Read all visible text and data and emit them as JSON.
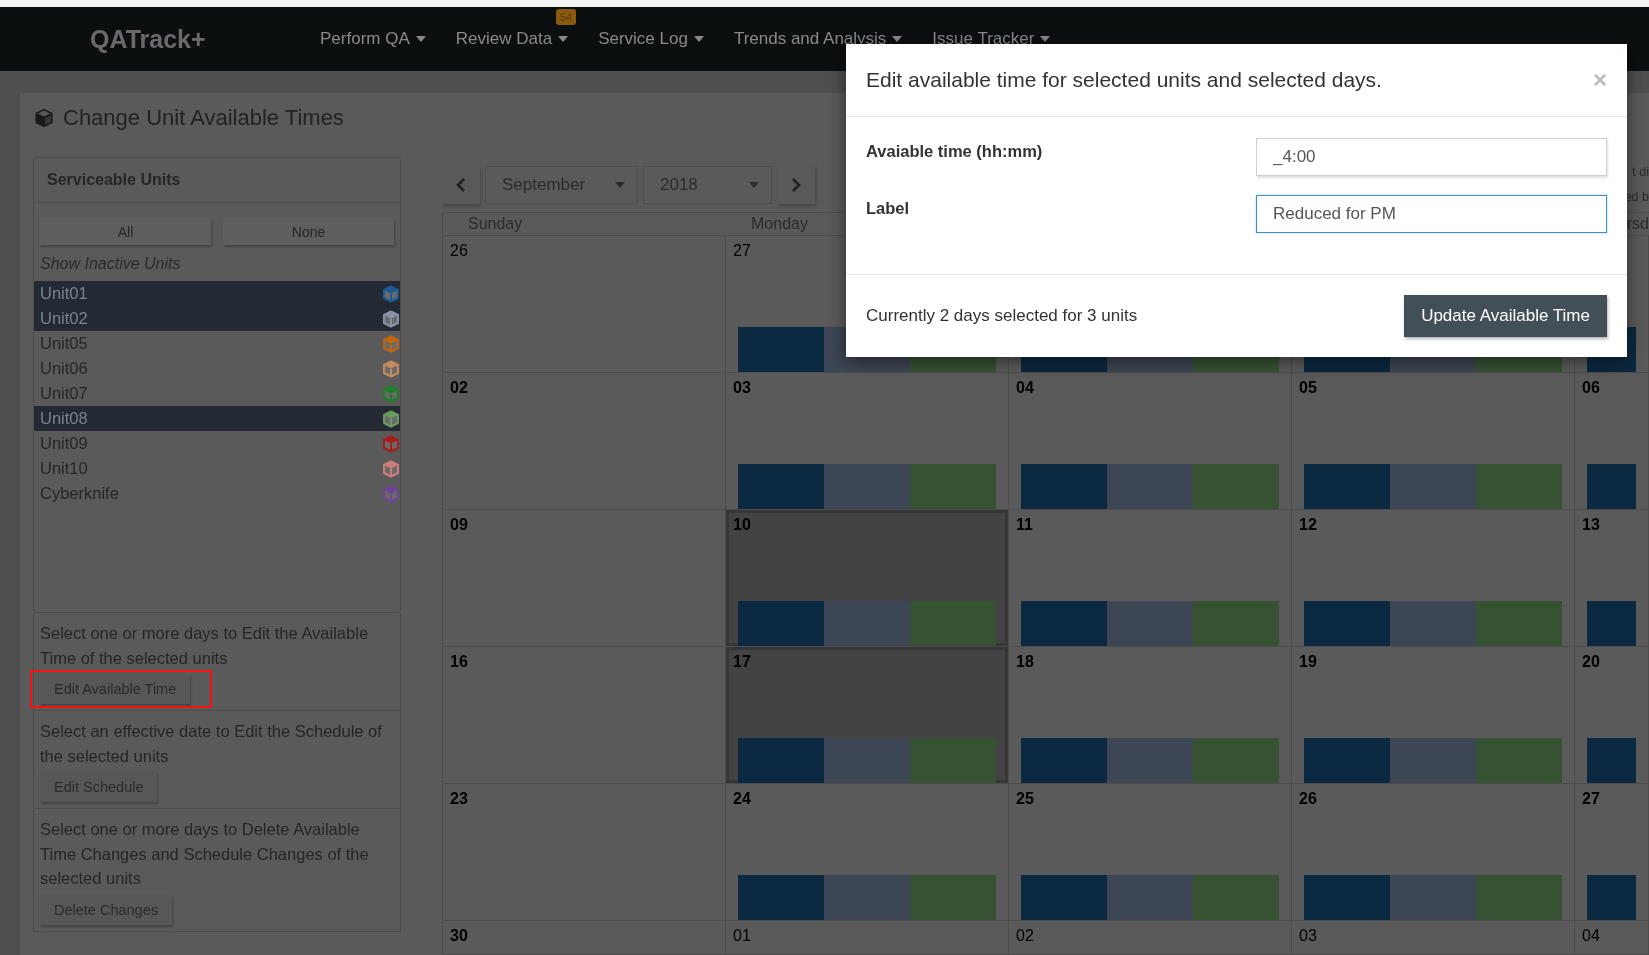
{
  "navbar": {
    "brand": "QATrack+",
    "items": [
      {
        "label": "Perform QA"
      },
      {
        "label": "Review Data",
        "badge": "54"
      },
      {
        "label": "Service Log"
      },
      {
        "label": "Trends and Analysis"
      },
      {
        "label": "Issue Tracker"
      }
    ]
  },
  "page": {
    "title": "Change Unit Available Times"
  },
  "units_panel": {
    "title": "Serviceable Units",
    "buttons": [
      "All",
      "None"
    ],
    "inactive_toggle": "Show Inactive Units",
    "units": [
      {
        "name": "Unit01",
        "selected": true,
        "color": "#1d5b94"
      },
      {
        "name": "Unit02",
        "selected": true,
        "color": "#8a93a6"
      },
      {
        "name": "Unit05",
        "selected": false,
        "color": "#c2660e"
      },
      {
        "name": "Unit06",
        "selected": false,
        "color": "#c48b5c"
      },
      {
        "name": "Unit07",
        "selected": false,
        "color": "#1e7f26"
      },
      {
        "name": "Unit08",
        "selected": true,
        "color": "#6a9a5e"
      },
      {
        "name": "Unit09",
        "selected": false,
        "color": "#a81b1b"
      },
      {
        "name": "Unit10",
        "selected": false,
        "color": "#d07c7c"
      },
      {
        "name": "Cyberknife",
        "selected": false,
        "color": "#6e4596"
      }
    ]
  },
  "actions": [
    {
      "text": "Select one or more days to Edit the Available Time of the selected units",
      "button": "Edit Available Time",
      "highlighted": true
    },
    {
      "text": "Select an effective date to Edit the Schedule of the selected units",
      "button": "Edit Schedule",
      "highlighted": false
    },
    {
      "text": "Select one or more days to Delete Available Time Changes and Schedule Changes of the selected units",
      "button": "Delete Changes",
      "highlighted": false
    }
  ],
  "calendar": {
    "month": "September",
    "year": "2018",
    "fragments": [
      "t di",
      "ed b"
    ],
    "weekday_headers": {
      "column_1": "Sunday",
      "column_2": "Monday",
      "column_5": "rsd"
    },
    "weeks": [
      [
        {
          "number": "26",
          "in_month": false,
          "selected": false,
          "bar": false
        },
        {
          "number": "27",
          "in_month": false,
          "selected": false,
          "bar": true
        },
        {
          "selected": false,
          "bar": true
        },
        {
          "selected": false,
          "bar": true
        },
        {
          "selected": false,
          "bar": true
        }
      ],
      [
        {
          "number": "02",
          "in_month": true,
          "selected": false,
          "bar": false
        },
        {
          "number": "03",
          "in_month": true,
          "selected": false,
          "bar": true
        },
        {
          "number": "04",
          "in_month": true,
          "selected": false,
          "bar": true
        },
        {
          "number": "05",
          "in_month": true,
          "selected": false,
          "bar": true
        },
        {
          "number": "06",
          "in_month": true,
          "selected": false,
          "bar": true
        }
      ],
      [
        {
          "number": "09",
          "in_month": true,
          "selected": false,
          "bar": false
        },
        {
          "number": "10",
          "in_month": true,
          "selected": true,
          "bar": true
        },
        {
          "number": "11",
          "in_month": true,
          "selected": false,
          "bar": true
        },
        {
          "number": "12",
          "in_month": true,
          "selected": false,
          "bar": true
        },
        {
          "number": "13",
          "in_month": true,
          "selected": false,
          "bar": true
        }
      ],
      [
        {
          "number": "16",
          "in_month": true,
          "selected": false,
          "bar": false
        },
        {
          "number": "17",
          "in_month": true,
          "selected": true,
          "bar": true
        },
        {
          "number": "18",
          "in_month": true,
          "selected": false,
          "bar": true
        },
        {
          "number": "19",
          "in_month": true,
          "selected": false,
          "bar": true
        },
        {
          "number": "20",
          "in_month": true,
          "selected": false,
          "bar": true
        }
      ],
      [
        {
          "number": "23",
          "in_month": true,
          "selected": false,
          "bar": false
        },
        {
          "number": "24",
          "in_month": true,
          "selected": false,
          "bar": true
        },
        {
          "number": "25",
          "in_month": true,
          "selected": false,
          "bar": true
        },
        {
          "number": "26",
          "in_month": true,
          "selected": false,
          "bar": true
        },
        {
          "number": "27",
          "in_month": true,
          "selected": false,
          "bar": true
        }
      ],
      [
        {
          "number": "30",
          "in_month": true,
          "selected": false,
          "bar": false
        },
        {
          "number": "01",
          "in_month": false,
          "selected": false,
          "bar": false
        },
        {
          "number": "02",
          "in_month": false,
          "selected": false,
          "bar": false
        },
        {
          "number": "03",
          "in_month": false,
          "selected": false,
          "bar": false
        },
        {
          "number": "04",
          "in_month": false,
          "selected": false,
          "bar": false
        }
      ]
    ]
  },
  "modal": {
    "title": "Edit available time for selected units and selected days.",
    "close": "×",
    "fields": [
      {
        "label": "Avaiable time (hh:mm)",
        "value": "_4:00",
        "focused": false
      },
      {
        "label": "Label",
        "value": "Reduced for PM",
        "focused": true
      }
    ],
    "summary": "Currently 2 days selected for 3 units",
    "submit": "Update Available Time"
  }
}
